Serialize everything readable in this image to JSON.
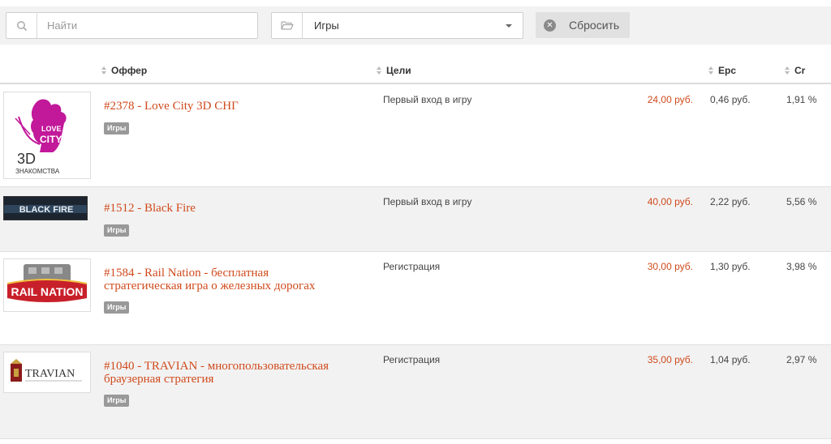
{
  "search": {
    "placeholder": "Найти",
    "value": ""
  },
  "category_filter": {
    "selected": "Игры"
  },
  "reset_button": {
    "label": "Сбросить"
  },
  "table": {
    "headers": {
      "offer": "Оффер",
      "goals": "Цели",
      "epc": "Epc",
      "cr": "Cr"
    },
    "rows": [
      {
        "logo": "love-city-3d-logo",
        "logo_text": [
          "LOVE",
          "CITY",
          "3D",
          "ЗНАКОМСТВА"
        ],
        "title": "#2378 - Love City 3D СНГ",
        "tag": "Игры",
        "goal": "Первый вход в игру",
        "payout": "24,00 руб.",
        "epc": "0,46 руб.",
        "cr": "1,91 %"
      },
      {
        "logo": "black-fire-logo",
        "logo_text": [
          "BLACK FIRE"
        ],
        "title": "#1512 - Black Fire",
        "tag": "Игры",
        "goal": "Первый вход в игру",
        "payout": "40,00 руб.",
        "epc": "2,22 руб.",
        "cr": "5,56 %"
      },
      {
        "logo": "rail-nation-logo",
        "logo_text": [
          "RAIL NATION"
        ],
        "title_lines": [
          "#1584 - Rail Nation - бесплатная",
          "стратегическая игра о железных дорогах"
        ],
        "tag": "Игры",
        "goal": "Регистрация",
        "payout": "30,00 руб.",
        "epc": "1,30 руб.",
        "cr": "3,98 %"
      },
      {
        "logo": "travian-logo",
        "logo_text": [
          "TRAVIAN"
        ],
        "title_lines": [
          "#1040 - TRAVIAN - многопользовательская",
          "браузерная стратегия"
        ],
        "tag": "Игры",
        "goal": "Регистрация",
        "payout": "35,00 руб.",
        "epc": "1,04 руб.",
        "cr": "2,97 %"
      }
    ]
  },
  "colors": {
    "accent": "#d04a1c",
    "tag_bg": "#999999",
    "stripe": "#f2f2f2"
  }
}
